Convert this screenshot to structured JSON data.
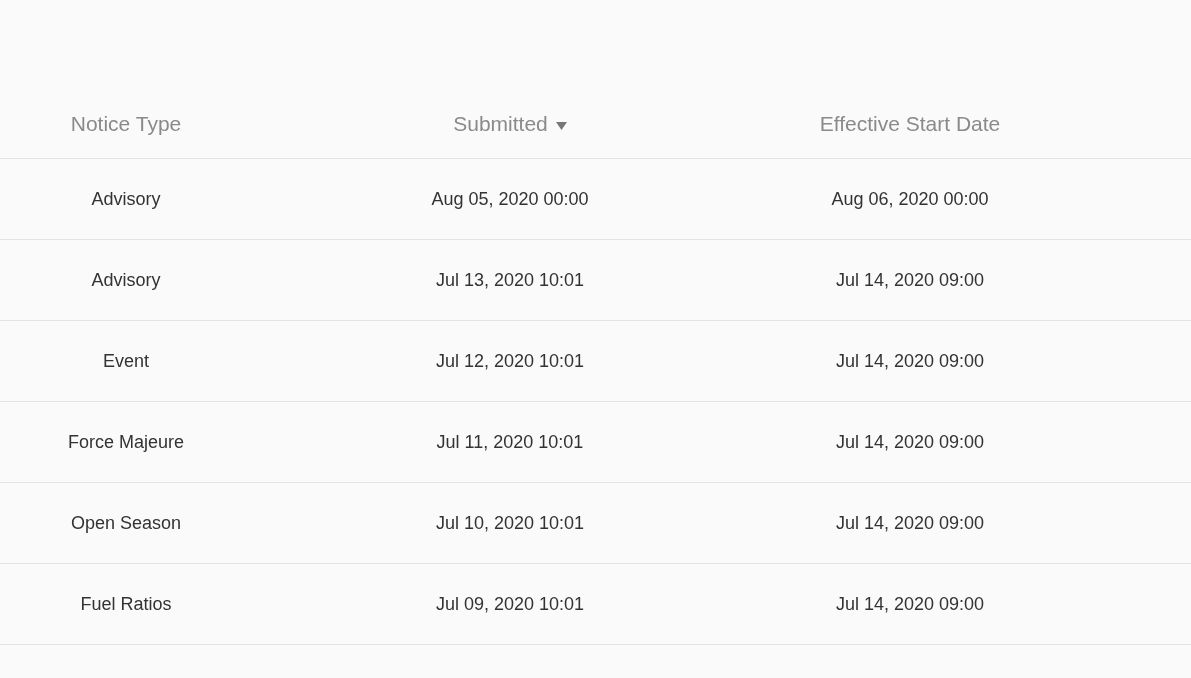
{
  "table": {
    "columns": [
      {
        "label": "Notice Type",
        "sorted": false
      },
      {
        "label": "Submitted",
        "sorted": true
      },
      {
        "label": "Effective Start Date",
        "sorted": false
      }
    ],
    "rows": [
      {
        "cells": [
          "Advisory",
          "Aug 05, 2020 00:00",
          "Aug 06, 2020 00:00"
        ]
      },
      {
        "cells": [
          "Advisory",
          "Jul 13, 2020 10:01",
          "Jul 14, 2020 09:00"
        ]
      },
      {
        "cells": [
          "Event",
          "Jul 12, 2020 10:01",
          "Jul 14, 2020 09:00"
        ]
      },
      {
        "cells": [
          "Force Majeure",
          "Jul 11, 2020 10:01",
          "Jul 14, 2020 09:00"
        ]
      },
      {
        "cells": [
          "Open Season",
          "Jul 10, 2020 10:01",
          "Jul 14, 2020 09:00"
        ]
      },
      {
        "cells": [
          "Fuel Ratios",
          "Jul 09, 2020 10:01",
          "Jul 14, 2020 09:00"
        ]
      }
    ]
  }
}
